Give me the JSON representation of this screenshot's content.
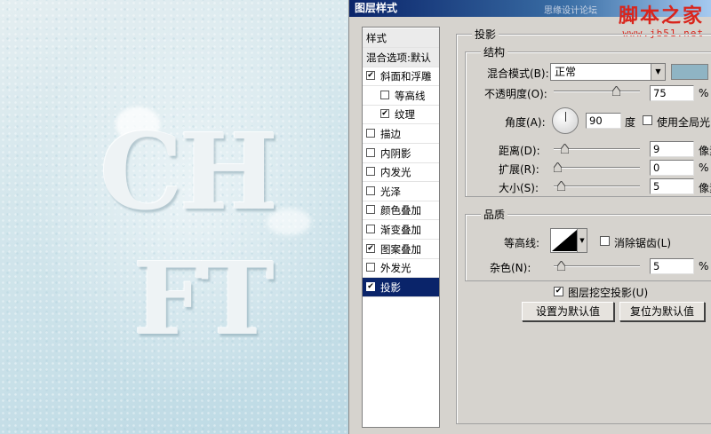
{
  "canvas": {
    "art_line1": "CH",
    "art_line2": "FT"
  },
  "dialog": {
    "title": "图层样式",
    "watermark_small": "思缘设计论坛",
    "watermark_logo": "脚本之家",
    "watermark_url": "www.jb51.net"
  },
  "style_list": {
    "items": [
      {
        "label": "样式",
        "checked": false,
        "has_checkbox": false,
        "indent": false
      },
      {
        "label": "混合选项:默认",
        "checked": false,
        "has_checkbox": false,
        "indent": false
      },
      {
        "label": "斜面和浮雕",
        "checked": true,
        "has_checkbox": true,
        "indent": false
      },
      {
        "label": "等高线",
        "checked": false,
        "has_checkbox": true,
        "indent": true
      },
      {
        "label": "纹理",
        "checked": true,
        "has_checkbox": true,
        "indent": true
      },
      {
        "label": "描边",
        "checked": false,
        "has_checkbox": true,
        "indent": false
      },
      {
        "label": "内阴影",
        "checked": false,
        "has_checkbox": true,
        "indent": false
      },
      {
        "label": "内发光",
        "checked": false,
        "has_checkbox": true,
        "indent": false
      },
      {
        "label": "光泽",
        "checked": false,
        "has_checkbox": true,
        "indent": false
      },
      {
        "label": "颜色叠加",
        "checked": false,
        "has_checkbox": true,
        "indent": false
      },
      {
        "label": "渐变叠加",
        "checked": false,
        "has_checkbox": true,
        "indent": false
      },
      {
        "label": "图案叠加",
        "checked": true,
        "has_checkbox": true,
        "indent": false
      },
      {
        "label": "外发光",
        "checked": false,
        "has_checkbox": true,
        "indent": false
      },
      {
        "label": "投影",
        "checked": true,
        "has_checkbox": true,
        "indent": false,
        "selected": true
      }
    ]
  },
  "drop_shadow": {
    "section_title": "投影",
    "structure_title": "结构",
    "blend_mode_label": "混合模式(B):",
    "blend_mode_value": "正常",
    "shadow_color": "#8fb4c4",
    "opacity_label": "不透明度(O):",
    "opacity_value": "75",
    "opacity_unit": "%",
    "angle_label": "角度(A):",
    "angle_value": "90",
    "angle_unit": "度",
    "global_light_label": "使用全局光(G)",
    "global_light_checked": false,
    "distance_label": "距离(D):",
    "distance_value": "9",
    "distance_unit": "像素",
    "spread_label": "扩展(R):",
    "spread_value": "0",
    "spread_unit": "%",
    "size_label": "大小(S):",
    "size_value": "5",
    "size_unit": "像素",
    "quality_title": "品质",
    "contour_label": "等高线:",
    "antialias_label": "消除锯齿(L)",
    "antialias_checked": false,
    "noise_label": "杂色(N):",
    "noise_value": "5",
    "noise_unit": "%",
    "knockout_label": "图层挖空投影(U)",
    "knockout_checked": true,
    "make_default_label": "设置为默认值",
    "reset_default_label": "复位为默认值"
  },
  "sliders": {
    "opacity": 0.75,
    "distance": 0.09,
    "spread": 0.0,
    "size": 0.05,
    "noise": 0.05
  }
}
